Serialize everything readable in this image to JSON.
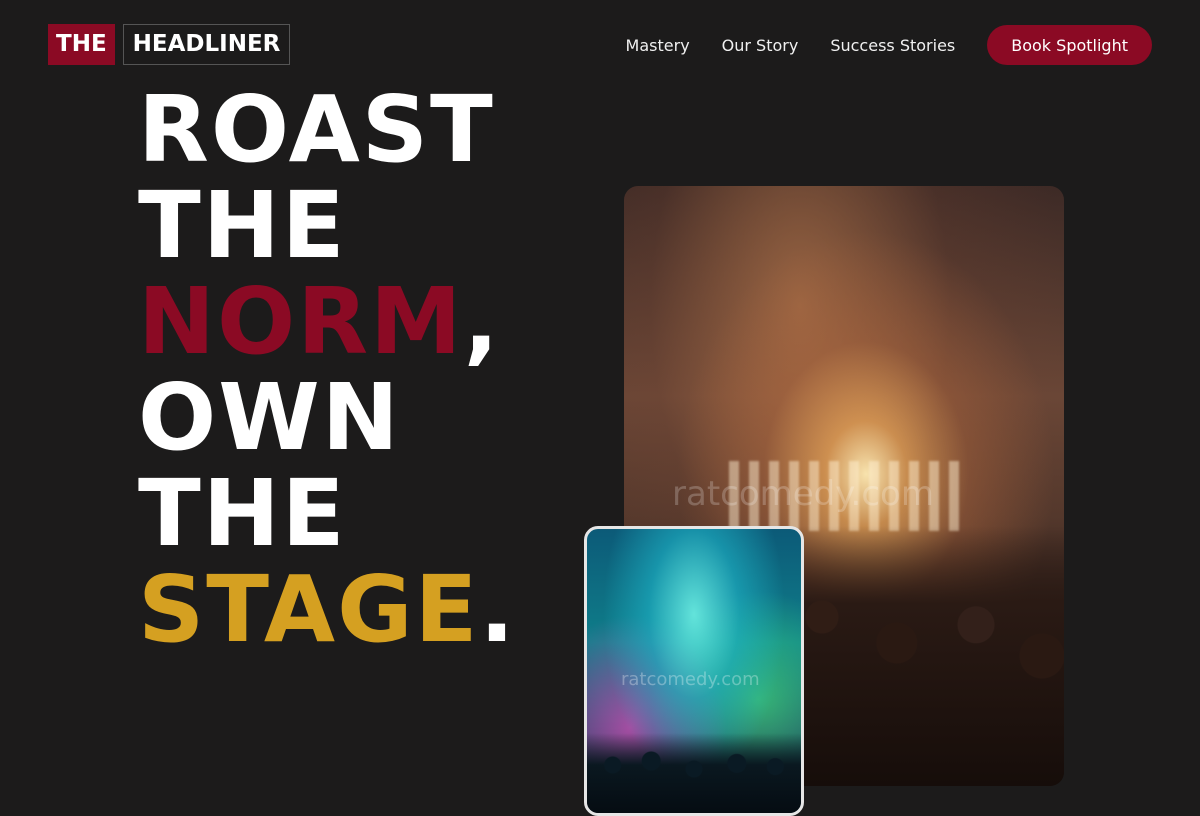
{
  "brand": {
    "part1": "THE",
    "part2": "HEADLINER"
  },
  "nav": {
    "items": [
      {
        "label": "Mastery"
      },
      {
        "label": "Our Story"
      },
      {
        "label": "Success Stories"
      }
    ],
    "cta_label": "Book Spotlight"
  },
  "hero": {
    "line1": "ROAST",
    "line2": "THE",
    "line3_word": "NORM",
    "line3_punct": ",",
    "line4": "OWN",
    "line5": "THE",
    "line6_word": "STAGE",
    "line6_punct": "."
  },
  "images": {
    "main_watermark": "ratcomedy.com",
    "small_watermark": "ratcomedy.com"
  },
  "colors": {
    "background": "#1c1b1b",
    "accent_red": "#8b0a24",
    "accent_gold": "#d5a021"
  }
}
